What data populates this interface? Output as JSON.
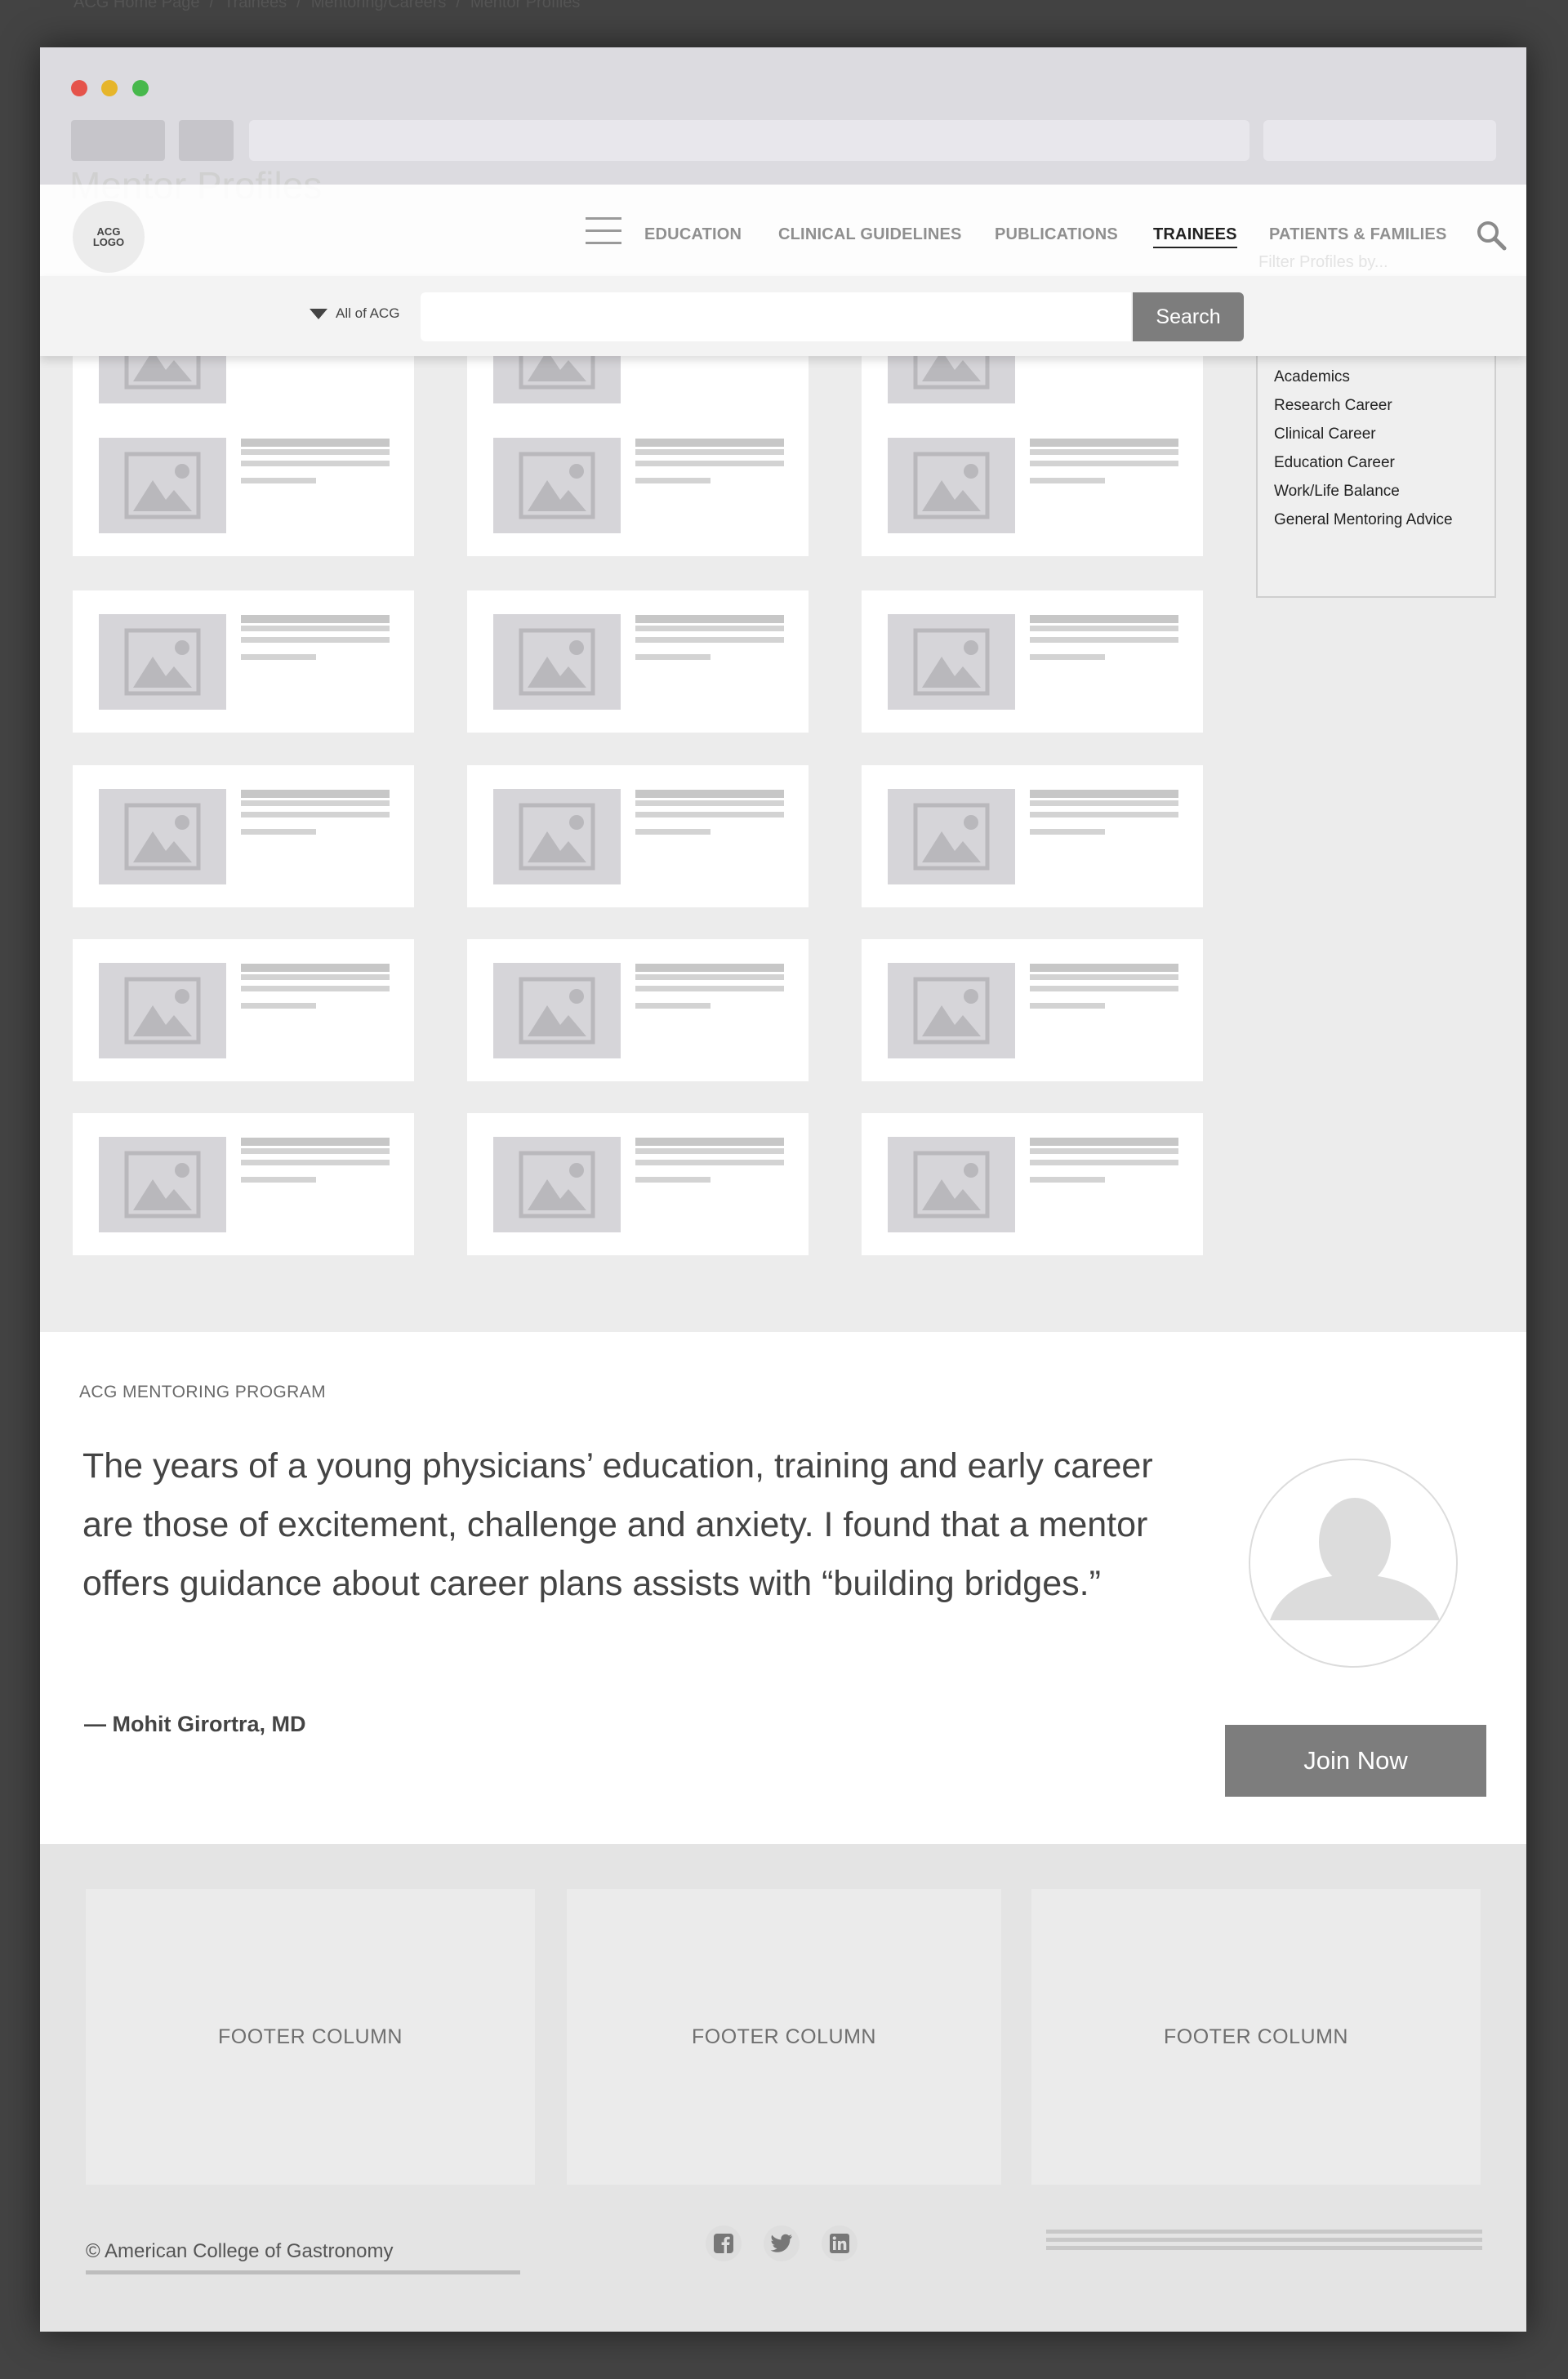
{
  "breadcrumb": [
    "ACG Home Page",
    "Trainees",
    "Mentoring/Careers",
    "Mentor Profiles"
  ],
  "page_title": "Mentor Profiles",
  "logo": {
    "line1": "ACG",
    "line2": "LOGO"
  },
  "nav": {
    "items": [
      {
        "label": "EDUCATION",
        "active": false
      },
      {
        "label": "CLINICAL GUIDELINES",
        "active": false
      },
      {
        "label": "PUBLICATIONS",
        "active": false
      },
      {
        "label": "TRAINEES",
        "active": true
      },
      {
        "label": "PATIENTS & FAMILIES",
        "active": false
      }
    ]
  },
  "search": {
    "scope_label": "All of ACG",
    "input_value": "",
    "button_label": "Search"
  },
  "filter": {
    "placeholder": "Filter Profiles by...",
    "items": [
      "Academics",
      "Research Career",
      "Clinical Career",
      "Education Career",
      "Work/Life Balance",
      "General Mentoring Advice"
    ]
  },
  "mentoring": {
    "eyebrow": "ACG MENTORING PROGRAM",
    "quote": "The years of a young physicians’ education, training and early career are those of excitement, challenge and anxiety. I found that a mentor offers guidance about career plans assists with “building bridges.”",
    "attribution": "— Mohit Girortra, MD",
    "join_label": "Join Now"
  },
  "footer": {
    "columns": [
      "FOOTER COLUMN",
      "FOOTER COLUMN",
      "FOOTER COLUMN"
    ],
    "copyright": "© American College of Gastronomy",
    "social_icons": [
      "facebook-icon",
      "twitter-icon",
      "linkedin-icon"
    ]
  },
  "colors": {
    "primary_button": "#7d7d7d",
    "window_bg": "#ececec",
    "placeholder_gray": "#d6d5d9"
  }
}
